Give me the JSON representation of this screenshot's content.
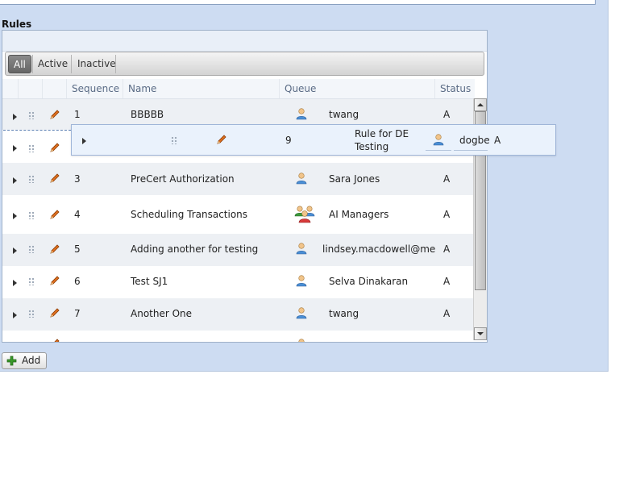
{
  "section": {
    "title": "Rules"
  },
  "filters": [
    {
      "label": "All",
      "active": true
    },
    {
      "label": "Active",
      "active": false
    },
    {
      "label": "Inactive",
      "active": false
    }
  ],
  "columns": {
    "sequence": "Sequence",
    "name": "Name",
    "queue": "Queue",
    "status": "Status"
  },
  "rows": [
    {
      "sequence": "1",
      "name": "BBBBB",
      "queue": "twang",
      "queue_icon": "user-icon",
      "status": "A"
    },
    {
      "sequence": "",
      "name": "",
      "queue": "",
      "queue_icon": "",
      "status": ""
    },
    {
      "sequence": "3",
      "name": "PreCert Authorization",
      "queue": "Sara Jones",
      "queue_icon": "user-icon",
      "status": "A"
    },
    {
      "sequence": "4",
      "name": "Scheduling Transactions",
      "queue": "AI Managers",
      "queue_icon": "group-icon",
      "status": "A"
    },
    {
      "sequence": "5",
      "name": "Adding another for testing",
      "queue": "lindsey.macdowell@meda:",
      "queue_icon": "user-icon",
      "status": "A"
    },
    {
      "sequence": "6",
      "name": "Test SJ1",
      "queue": "Selva Dinakaran",
      "queue_icon": "user-icon",
      "status": "A"
    },
    {
      "sequence": "7",
      "name": "Another One",
      "queue": "twang",
      "queue_icon": "user-icon",
      "status": "A"
    }
  ],
  "dragged_row": {
    "sequence": "9",
    "name_line1": "Rule for DE",
    "name_line2": "Testing",
    "queue": "dogbe",
    "status": "A"
  },
  "add_button": {
    "label": "Add"
  },
  "colors": {
    "panel": "#cddcf2",
    "accent_icon": "#e07020",
    "add_icon": "#3a9a2a"
  }
}
